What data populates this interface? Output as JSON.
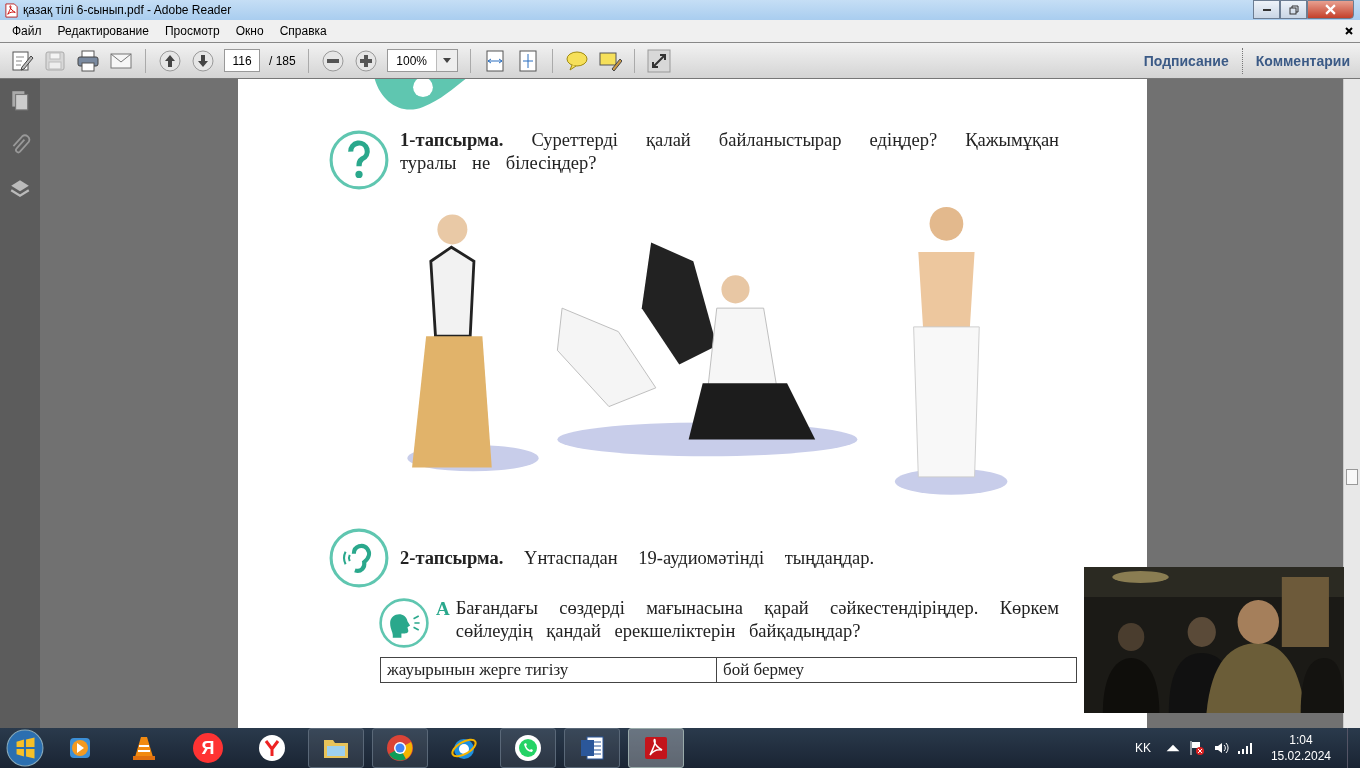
{
  "window": {
    "title": "қазақ тілі 6-сынып.pdf - Adobe Reader"
  },
  "menu": [
    "Файл",
    "Редактирование",
    "Просмотр",
    "Окно",
    "Справка"
  ],
  "toolbar": {
    "page_current": "116",
    "page_total": "/ 185",
    "zoom": "100%",
    "links": [
      "Подписание",
      "Комментарии"
    ]
  },
  "document": {
    "tasks": [
      {
        "kind": "question",
        "text": "**1-тапсырма.** Суреттерді қалай байланыстырар едіңдер? Қажымұқан туралы не білесіңдер?"
      },
      {
        "kind": "picture"
      },
      {
        "kind": "listen",
        "text": "**2-тапсырма.** Үнтаспадан 19-аудиомәтінді тыңдаңдар."
      },
      {
        "kind": "speak",
        "marker": "А",
        "text": "Бағандағы сөздерді мағынасына қарай сәйкестендіріңдер. Көркем сөйлеудің қандай ерекшеліктерін байқадыңдар?"
      }
    ],
    "table_row": [
      "жауырынын жерге тигізу",
      "бой бермеу"
    ]
  },
  "video": {
    "kind": "picture"
  },
  "taskbar": [
    {
      "kind": "wmp",
      "running": false,
      "selected": false
    },
    {
      "kind": "vlc",
      "running": false,
      "selected": false
    },
    {
      "kind": "yandex",
      "glyph": "Я",
      "running": false,
      "selected": false
    },
    {
      "kind": "ybrowser",
      "running": false,
      "selected": false
    },
    {
      "kind": "folder",
      "running": true,
      "selected": false
    },
    {
      "kind": "chrome",
      "running": true,
      "selected": false
    },
    {
      "kind": "ie",
      "running": false,
      "selected": false
    },
    {
      "kind": "whatsapp",
      "running": true,
      "selected": false
    },
    {
      "kind": "word",
      "running": true,
      "selected": false
    },
    {
      "kind": "acrobat",
      "running": true,
      "selected": true
    }
  ],
  "tray": {
    "language": "KK",
    "time": "1:04",
    "date": "15.02.2024"
  }
}
